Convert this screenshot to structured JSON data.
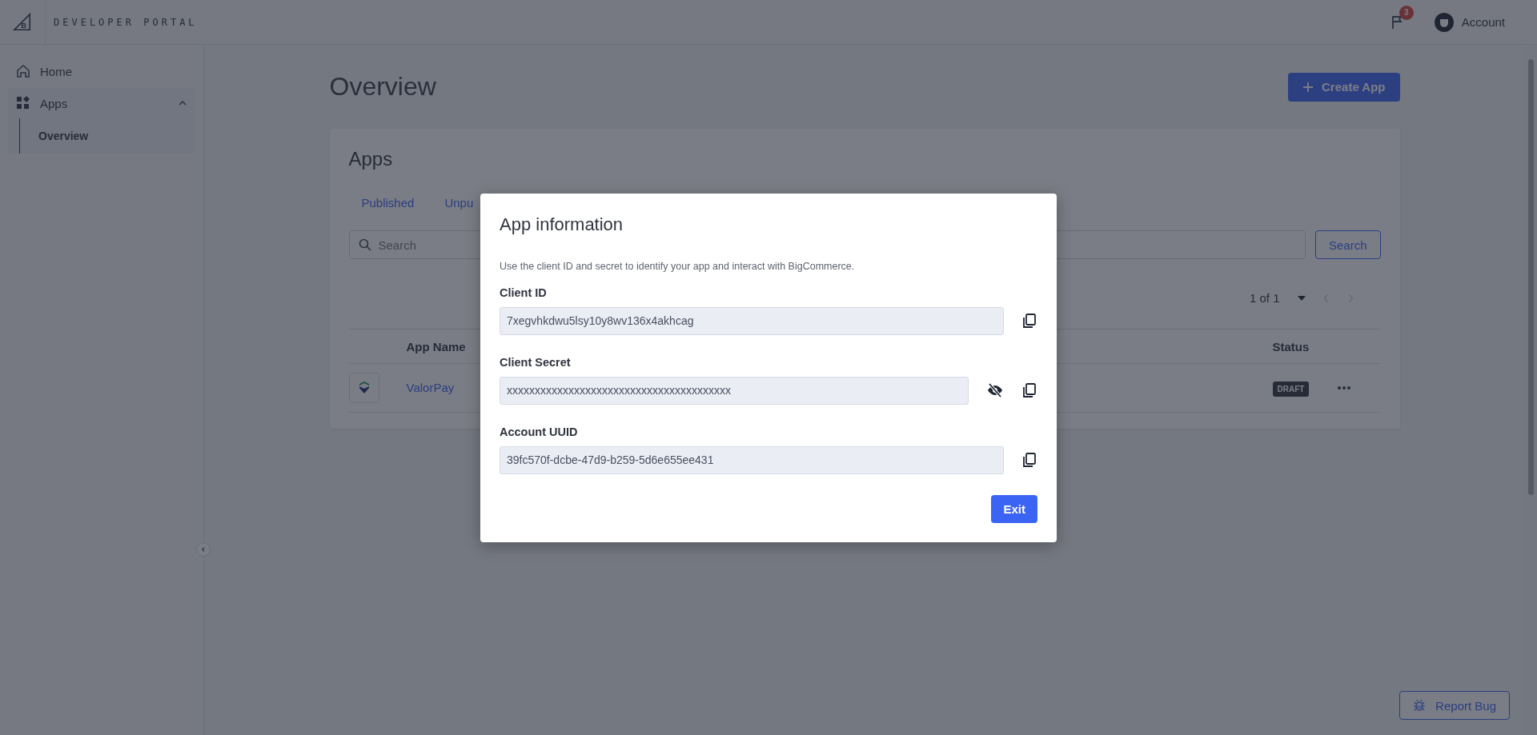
{
  "header": {
    "logo": "B",
    "brand": "DEVELOPER PORTAL",
    "notifications": {
      "count": "3"
    },
    "account": {
      "label": "Account"
    }
  },
  "sidebar": {
    "items": [
      {
        "label": "Home"
      },
      {
        "label": "Apps",
        "expanded": true,
        "children": [
          {
            "label": "Overview",
            "selected": true
          }
        ]
      }
    ]
  },
  "page": {
    "title": "Overview",
    "create_button": "Create App"
  },
  "apps_card": {
    "title": "Apps",
    "tabs": [
      {
        "label": "Published"
      },
      {
        "label": "Unpu"
      }
    ],
    "search": {
      "placeholder": "Search",
      "button": "Search"
    },
    "pagination": {
      "label": "1 of 1"
    },
    "table": {
      "columns": [
        "App Name",
        "Status"
      ],
      "rows": [
        {
          "name": "ValorPay",
          "status": "DRAFT"
        }
      ]
    }
  },
  "report_bug": "Report Bug",
  "dialog": {
    "title": "App information",
    "description": "Use the client ID and secret to identify your app and interact with BigCommerce.",
    "fields": [
      {
        "label": "Client ID",
        "value": "7xegvhkdwu5lsy10y8wv136x4akhcag",
        "kind": "plain"
      },
      {
        "label": "Client Secret",
        "value": "xxxxxxxxxxxxxxxxxxxxxxxxxxxxxxxxxxxxxxxx",
        "kind": "secret",
        "visible": false
      },
      {
        "label": "Account UUID",
        "value": "39fc570f-dcbe-47d9-b259-5d6e655ee431",
        "kind": "plain"
      }
    ],
    "exit_button": "Exit"
  }
}
